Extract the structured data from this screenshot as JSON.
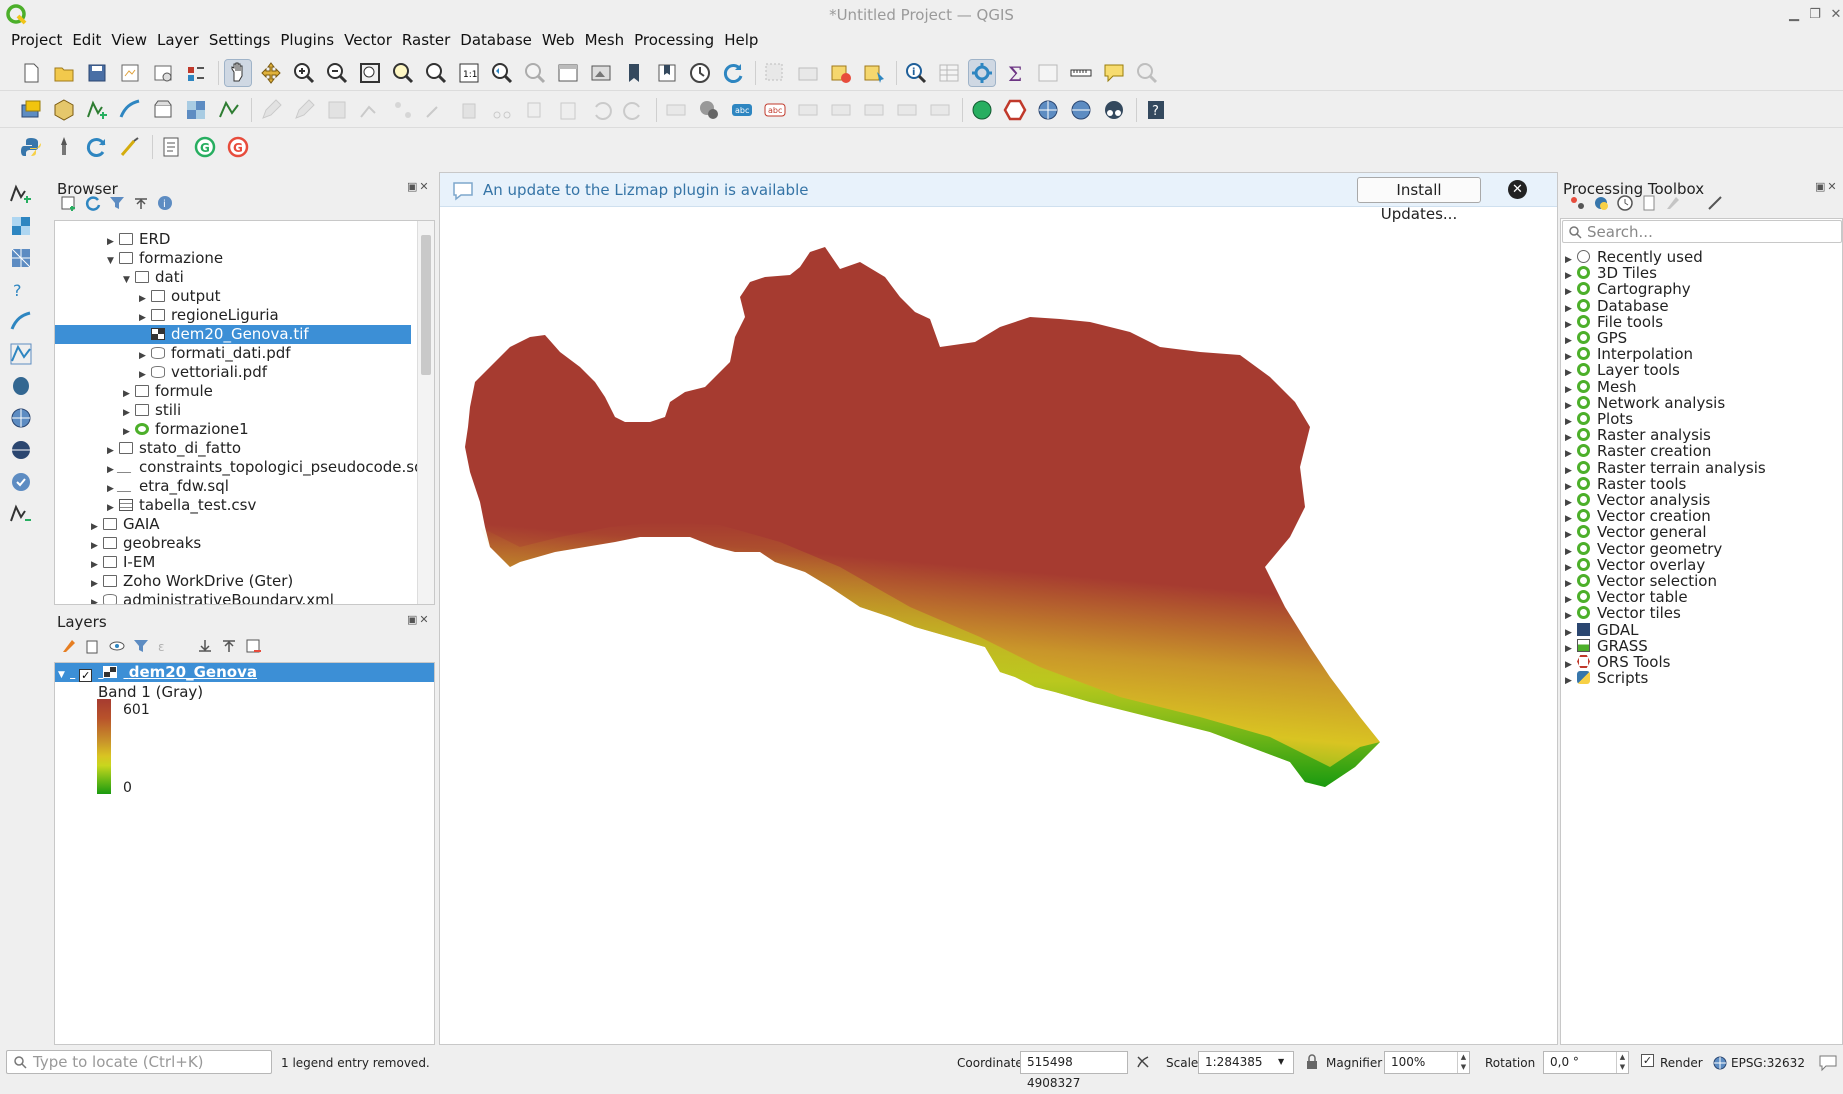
{
  "window": {
    "title": "*Untitled Project — QGIS"
  },
  "menu": [
    "Project",
    "Edit",
    "View",
    "Layer",
    "Settings",
    "Plugins",
    "Vector",
    "Raster",
    "Database",
    "Web",
    "Mesh",
    "Processing",
    "Help"
  ],
  "browser": {
    "title": "Browser",
    "items": [
      {
        "label": "ERD",
        "indent": 3,
        "icon": "folder",
        "expanded": false
      },
      {
        "label": "formazione",
        "indent": 3,
        "icon": "folder",
        "expanded": true
      },
      {
        "label": "dati",
        "indent": 4,
        "icon": "folder",
        "expanded": true
      },
      {
        "label": "output",
        "indent": 5,
        "icon": "folder",
        "expanded": false
      },
      {
        "label": "regioneLiguria",
        "indent": 5,
        "icon": "folder",
        "expanded": false
      },
      {
        "label": "dem20_Genova.tif",
        "indent": 5,
        "icon": "raster",
        "selected": true
      },
      {
        "label": "formati_dati.pdf",
        "indent": 5,
        "icon": "db",
        "expanded": false
      },
      {
        "label": "vettoriali.pdf",
        "indent": 5,
        "icon": "db",
        "expanded": false
      },
      {
        "label": "formule",
        "indent": 4,
        "icon": "folder",
        "expanded": false
      },
      {
        "label": "stili",
        "indent": 4,
        "icon": "folder",
        "expanded": false
      },
      {
        "label": "formazione1",
        "indent": 4,
        "icon": "qgis",
        "expanded": false
      },
      {
        "label": "stato_di_fatto",
        "indent": 3,
        "icon": "folder",
        "expanded": false
      },
      {
        "label": "constraints_topologici_pseudocode.sql",
        "indent": 3,
        "icon": "sql",
        "expanded": false
      },
      {
        "label": "etra_fdw.sql",
        "indent": 3,
        "icon": "sql",
        "expanded": false
      },
      {
        "label": "tabella_test.csv",
        "indent": 3,
        "icon": "table",
        "expanded": false
      },
      {
        "label": "GAIA",
        "indent": 2,
        "icon": "folder",
        "expanded": false
      },
      {
        "label": "geobreaks",
        "indent": 2,
        "icon": "folder",
        "expanded": false
      },
      {
        "label": "I-EM",
        "indent": 2,
        "icon": "folder",
        "expanded": false
      },
      {
        "label": "Zoho WorkDrive (Gter)",
        "indent": 2,
        "icon": "folder",
        "expanded": false
      },
      {
        "label": "administrativeBoundary.xml",
        "indent": 2,
        "icon": "db",
        "expanded": false
      }
    ]
  },
  "layers": {
    "title": "Layers",
    "layer_name": "dem20_Genova",
    "band_label": "Band 1 (Gray)",
    "max": "601",
    "min": "0"
  },
  "message_bar": {
    "text": "An update to the Lizmap plugin is available",
    "button": "Install Updates...",
    "close": "✕"
  },
  "processing": {
    "title": "Processing Toolbox",
    "search_placeholder": "Search...",
    "items": [
      {
        "label": "Recently used",
        "icon": "clock"
      },
      {
        "label": "3D Tiles",
        "icon": "qgis"
      },
      {
        "label": "Cartography",
        "icon": "qgis"
      },
      {
        "label": "Database",
        "icon": "qgis"
      },
      {
        "label": "File tools",
        "icon": "qgis"
      },
      {
        "label": "GPS",
        "icon": "qgis"
      },
      {
        "label": "Interpolation",
        "icon": "qgis"
      },
      {
        "label": "Layer tools",
        "icon": "qgis"
      },
      {
        "label": "Mesh",
        "icon": "qgis"
      },
      {
        "label": "Network analysis",
        "icon": "qgis"
      },
      {
        "label": "Plots",
        "icon": "qgis"
      },
      {
        "label": "Raster analysis",
        "icon": "qgis"
      },
      {
        "label": "Raster creation",
        "icon": "qgis"
      },
      {
        "label": "Raster terrain analysis",
        "icon": "qgis"
      },
      {
        "label": "Raster tools",
        "icon": "qgis"
      },
      {
        "label": "Vector analysis",
        "icon": "qgis"
      },
      {
        "label": "Vector creation",
        "icon": "qgis"
      },
      {
        "label": "Vector general",
        "icon": "qgis"
      },
      {
        "label": "Vector geometry",
        "icon": "qgis"
      },
      {
        "label": "Vector overlay",
        "icon": "qgis"
      },
      {
        "label": "Vector selection",
        "icon": "qgis"
      },
      {
        "label": "Vector table",
        "icon": "qgis"
      },
      {
        "label": "Vector tiles",
        "icon": "qgis"
      },
      {
        "label": "GDAL",
        "icon": "gdal"
      },
      {
        "label": "GRASS",
        "icon": "grass"
      },
      {
        "label": "ORS Tools",
        "icon": "ors"
      },
      {
        "label": "Scripts",
        "icon": "python"
      }
    ]
  },
  "statusbar": {
    "locator_placeholder": "Type to locate (Ctrl+K)",
    "message": "1 legend entry removed.",
    "coordinate_label": "Coordinate",
    "coordinate": "515498  4908327",
    "scale_label": "Scale",
    "scale": "1:284385",
    "magnifier_label": "Magnifier",
    "magnifier": "100%",
    "rotation_label": "Rotation",
    "rotation": "0,0 °",
    "render_label": "Render",
    "crs": "EPSG:32632"
  },
  "colors": {
    "selection": "#3c8fd6",
    "dem_high": "#a63b30",
    "dem_mid": "#d9c422",
    "dem_low": "#1a9a10",
    "message_text": "#3574a6"
  }
}
